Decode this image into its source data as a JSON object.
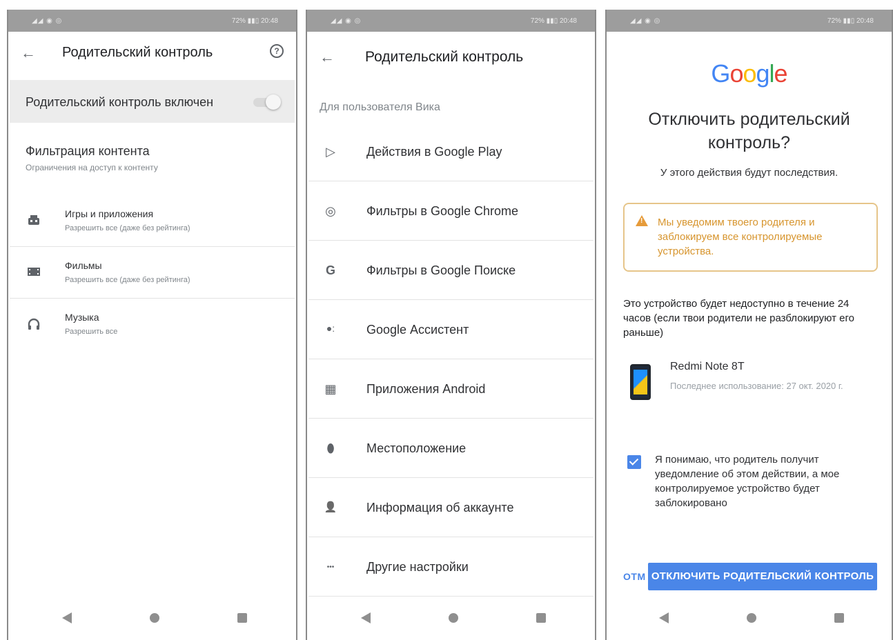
{
  "status": {
    "signal": "◢◢ ◉ ◎",
    "right": "72% ▮▮▯ 20:48"
  },
  "nav": {
    "back_icon": "triangle-back-icon",
    "home_icon": "circle-home-icon",
    "recents_icon": "square-recents-icon"
  },
  "screen1": {
    "title": "Родительский контроль",
    "help_glyph": "?",
    "master_label": "Родительский контроль включен",
    "filter_title": "Фильтрация контента",
    "filter_sub": "Ограничения на доступ к контенту",
    "categories": [
      {
        "icon": "games-icon",
        "title": "Игры и приложения",
        "sub": "Разрешить все (даже без рейтинга)"
      },
      {
        "icon": "movies-icon",
        "title": "Фильмы",
        "sub": "Разрешить все (даже без рейтинга)"
      },
      {
        "icon": "headphones-icon",
        "title": "Музыка",
        "sub": "Разрешить все"
      }
    ]
  },
  "screen2": {
    "title": "Родительский контроль",
    "section": "Для пользователя Вика",
    "items": [
      {
        "icon": "google-play-icon",
        "glyph": "▷",
        "label": "Действия в Google Play"
      },
      {
        "icon": "chrome-icon",
        "glyph": "◎",
        "label": "Фильтры в Google Chrome"
      },
      {
        "icon": "google-search-icon",
        "glyph": "G",
        "label": "Фильтры в Google Поиске"
      },
      {
        "icon": "assistant-icon",
        "glyph": "●:",
        "label": "Google Ассистент"
      },
      {
        "icon": "android-apps-icon",
        "glyph": "▦",
        "label": "Приложения Android"
      },
      {
        "icon": "location-pin-icon",
        "glyph": "⬮",
        "label": "Местоположение"
      },
      {
        "icon": "account-person-icon",
        "glyph": "👤",
        "label": "Информация об аккаунте"
      },
      {
        "icon": "more-dots-icon",
        "glyph": "•••",
        "label": "Другие настройки"
      }
    ]
  },
  "screen3": {
    "logo": [
      {
        "ch": "G",
        "color": "#4285F4"
      },
      {
        "ch": "o",
        "color": "#EA4335"
      },
      {
        "ch": "o",
        "color": "#FBBC05"
      },
      {
        "ch": "g",
        "color": "#4285F4"
      },
      {
        "ch": "l",
        "color": "#34A853"
      },
      {
        "ch": "e",
        "color": "#EA4335"
      }
    ],
    "title": "Отключить родительский контроль?",
    "subtitle": "У этого действия будут последствия.",
    "warning": "Мы уведомим твоего родителя и заблокируем все контролируемые устройства.",
    "lock_notice": "Это устройство будет недоступно в течение 24 часов (если твои родители не разблокируют его раньше)",
    "device_name": "Redmi Note 8T",
    "device_last_used": "Последнее использование: 27 окт. 2020 г.",
    "checkbox_checked": true,
    "checkbox_text": "Я понимаю, что родитель получит уведомление об этом действии, а мое контролируемое устройство будет заблокировано",
    "cancel_label": "ОТМ",
    "confirm_label": "ОТКЛЮЧИТЬ РОДИТЕЛЬСКИЙ КОНТРОЛЬ"
  }
}
